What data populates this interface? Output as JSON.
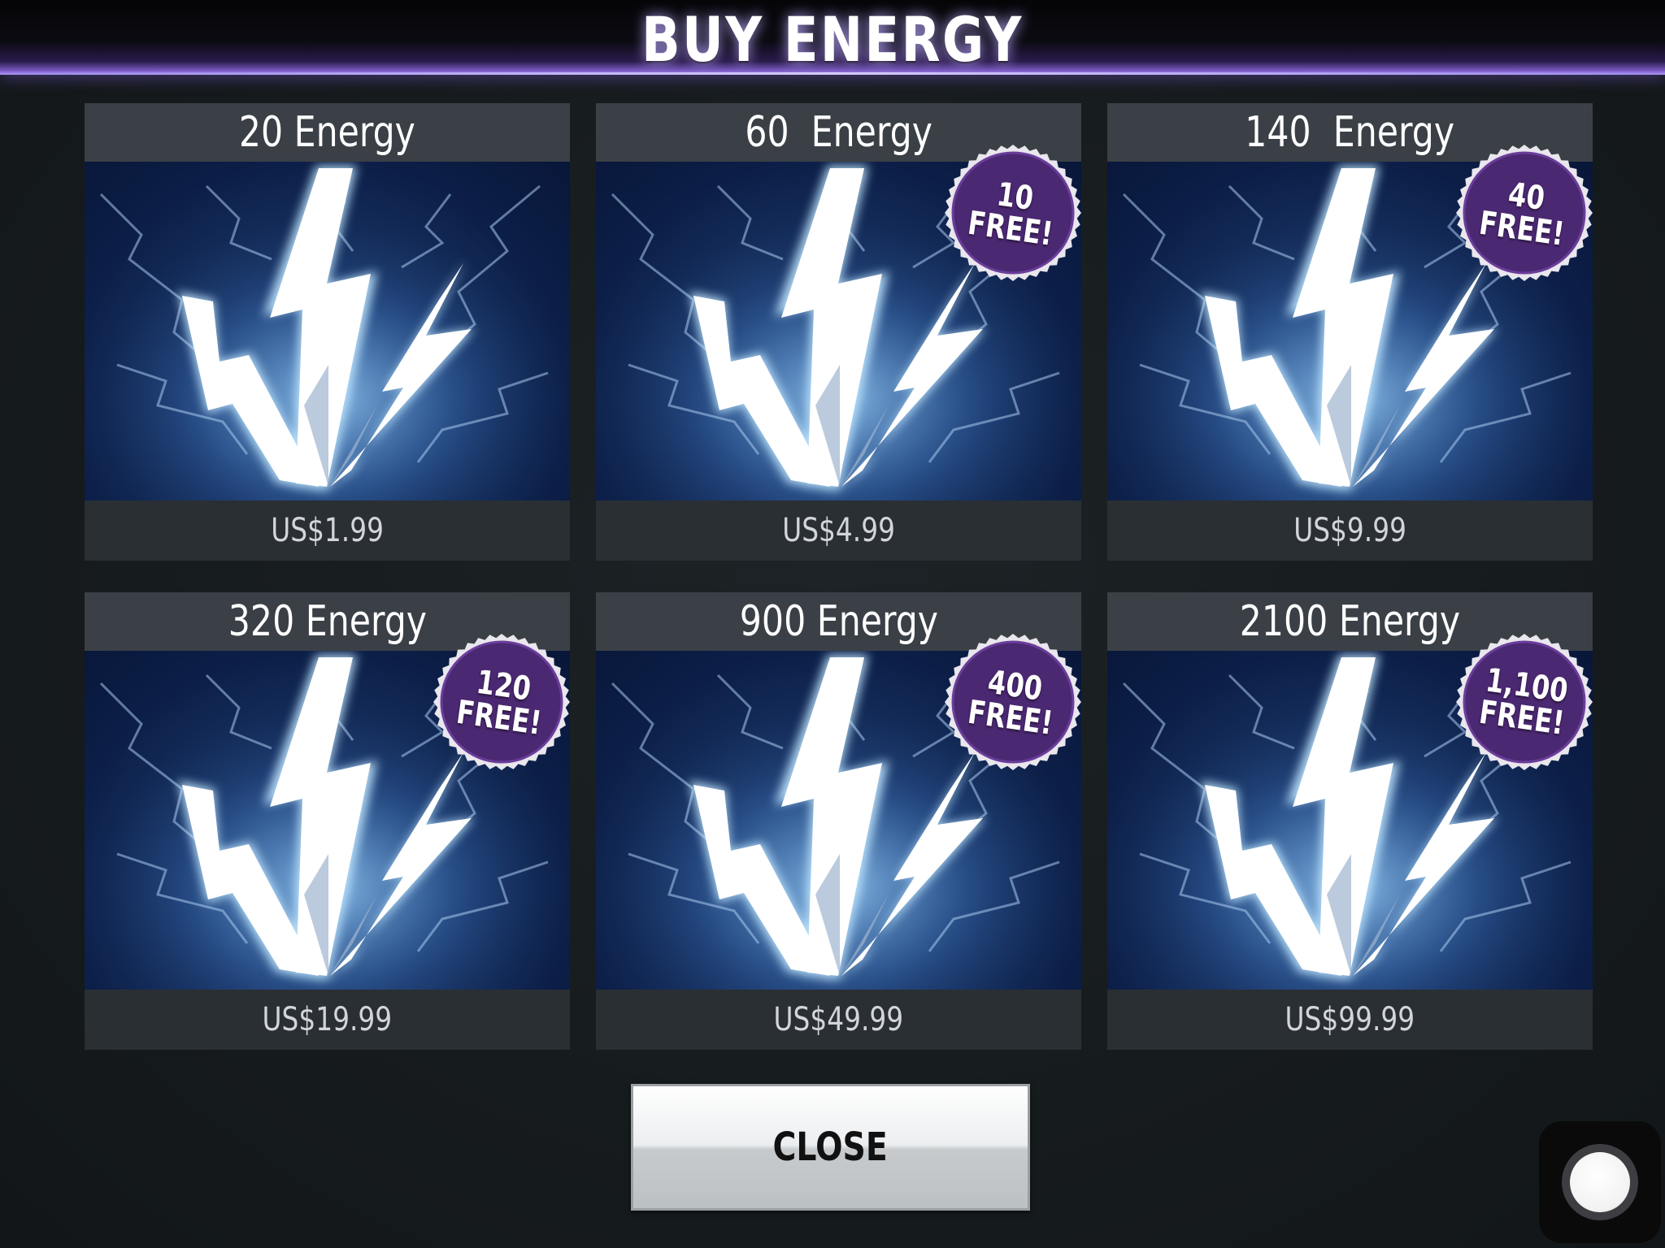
{
  "header": {
    "title": "BUY ENERGY"
  },
  "products": [
    {
      "name": "20 Energy",
      "price": "US$1.99",
      "bonus": null
    },
    {
      "name": "60  Energy",
      "price": "US$4.99",
      "bonus": {
        "amount": "10",
        "label": "FREE!"
      }
    },
    {
      "name": "140  Energy",
      "price": "US$9.99",
      "bonus": {
        "amount": "40",
        "label": "FREE!"
      }
    },
    {
      "name": "320 Energy",
      "price": "US$19.99",
      "bonus": {
        "amount": "120",
        "label": "FREE!"
      }
    },
    {
      "name": "900 Energy",
      "price": "US$49.99",
      "bonus": {
        "amount": "400",
        "label": "FREE!"
      }
    },
    {
      "name": "2100 Energy",
      "price": "US$99.99",
      "bonus": {
        "amount": "1,100",
        "label": "FREE!"
      }
    }
  ],
  "close_button": {
    "label": "CLOSE"
  },
  "colors": {
    "background": "#161b1d",
    "card_header": "#3a4046",
    "card_footer": "#2a2f33",
    "art_blue": "#0c1f48",
    "badge_purple": "#4b2872",
    "header_glow": "#b9a6ff"
  },
  "icons": {
    "product_art": "lightning-bolt-icon",
    "assistive_touch": "assistive-touch-icon"
  }
}
